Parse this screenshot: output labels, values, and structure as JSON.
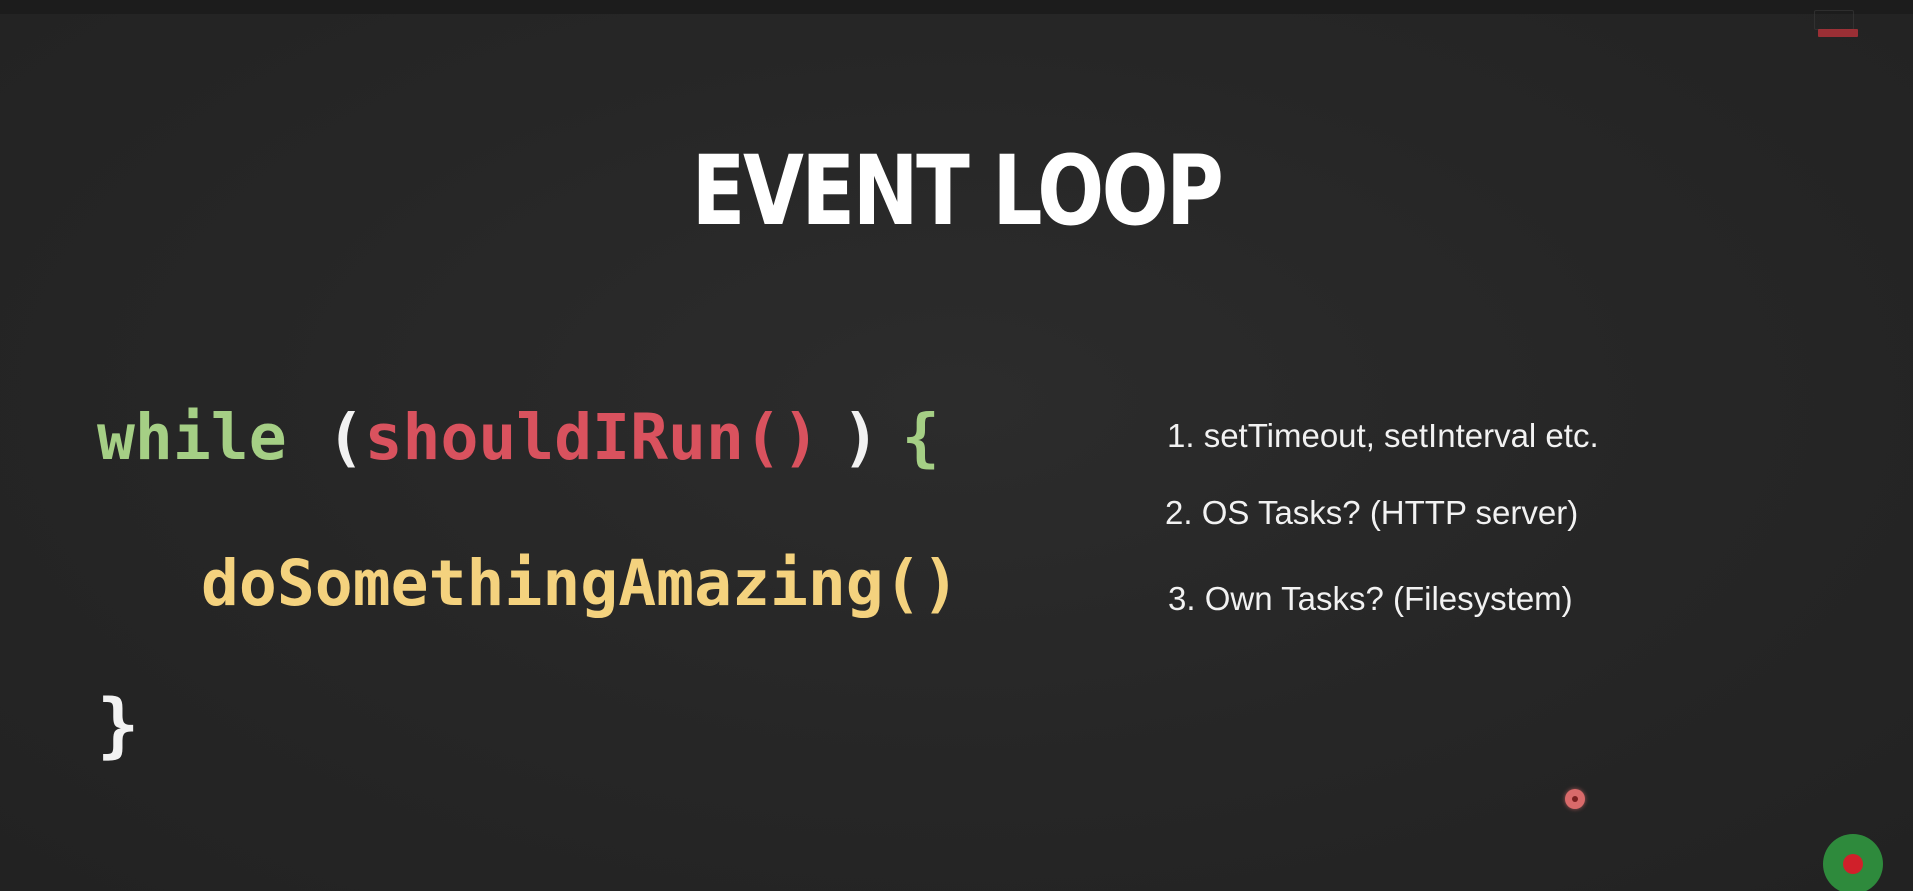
{
  "slide": {
    "title": "EVENT LOOP",
    "code": {
      "keyword_while": "while",
      "open_paren": "(",
      "condition_call": "shouldIRun()",
      "close_paren": ")",
      "open_brace": "{",
      "body_call": "doSomethingAmazing()",
      "close_brace": "}"
    },
    "list": [
      {
        "text": "1. setTimeout, setInterval etc."
      },
      {
        "text": "2. OS Tasks? (HTTP server)"
      },
      {
        "text": "3. Own Tasks? (Filesystem)"
      }
    ]
  },
  "colors": {
    "background": "#262626",
    "keyword_green": "#a5cf85",
    "function_red": "#d9525e",
    "function_yellow": "#f4d27e",
    "text_white": "#f2f2f2"
  },
  "icons": {
    "corner_logo": "conference-logo-icon",
    "pointer": "red-laser-pointer-icon",
    "record": "recording-indicator-icon"
  }
}
